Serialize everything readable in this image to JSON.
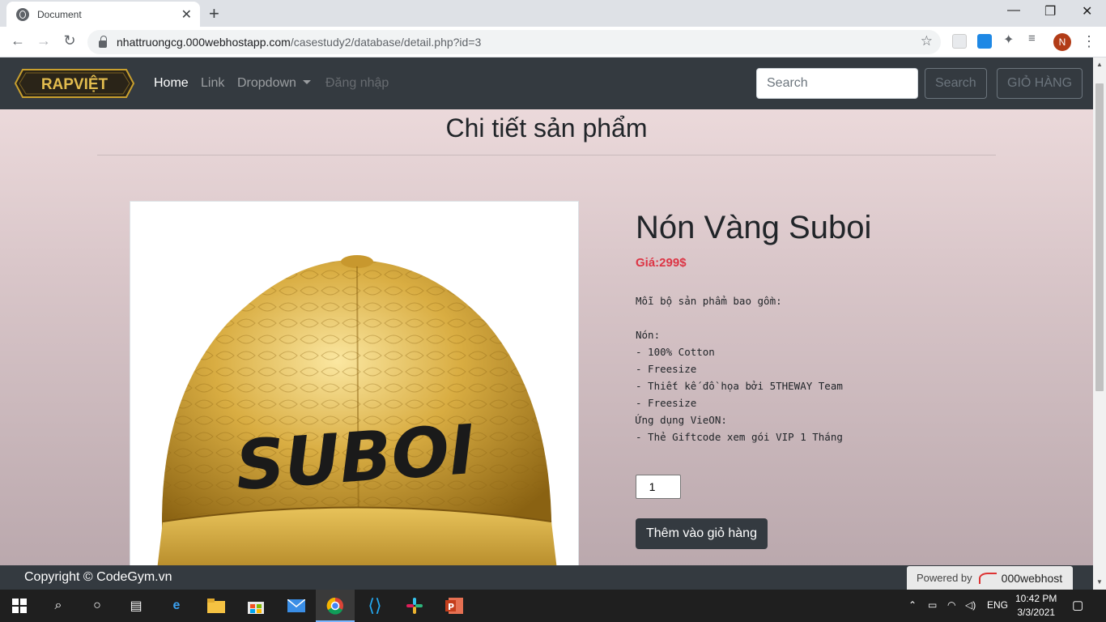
{
  "browser": {
    "tab_title": "Document",
    "url_host": "nhattruongcg.000webhostapp.com",
    "url_path": "/casestudy2/database/detail.php?id=3",
    "profile_initial": "N"
  },
  "navbar": {
    "logo_text": "RAPVIỆT",
    "links": [
      "Home",
      "Link",
      "Dropdown",
      "Đăng nhập"
    ],
    "search_placeholder": "Search",
    "search_button": "Search",
    "cart_button": "GIỎ HÀNG"
  },
  "page": {
    "heading": "Chi tiết sản phẩm"
  },
  "product": {
    "name": "Nón Vàng Suboi",
    "price": "Giá:299$",
    "image_text": "SUBOI",
    "description": "Mỗi bộ sản phẩm bao gồm:\n\nNón:\n- 100% Cotton\n- Freesize\n- Thiết kế đồ họa bởi 5THEWAY Team\n- Freesize\nỨng dụng VieON:\n- Thẻ Giftcode xem gói VIP 1 Tháng",
    "quantity": "1",
    "add_to_cart": "Thêm vào giỏ hàng"
  },
  "footer": {
    "copyright": "Copyright © CodeGym.vn",
    "powered_by": "Powered by",
    "powered_brand": "000webhost"
  },
  "taskbar": {
    "language": "ENG",
    "time": "10:42 PM",
    "date": "3/3/2021"
  },
  "colors": {
    "navbar_bg": "#343a40",
    "price": "#dc3545",
    "gold": "#c9a02e"
  }
}
